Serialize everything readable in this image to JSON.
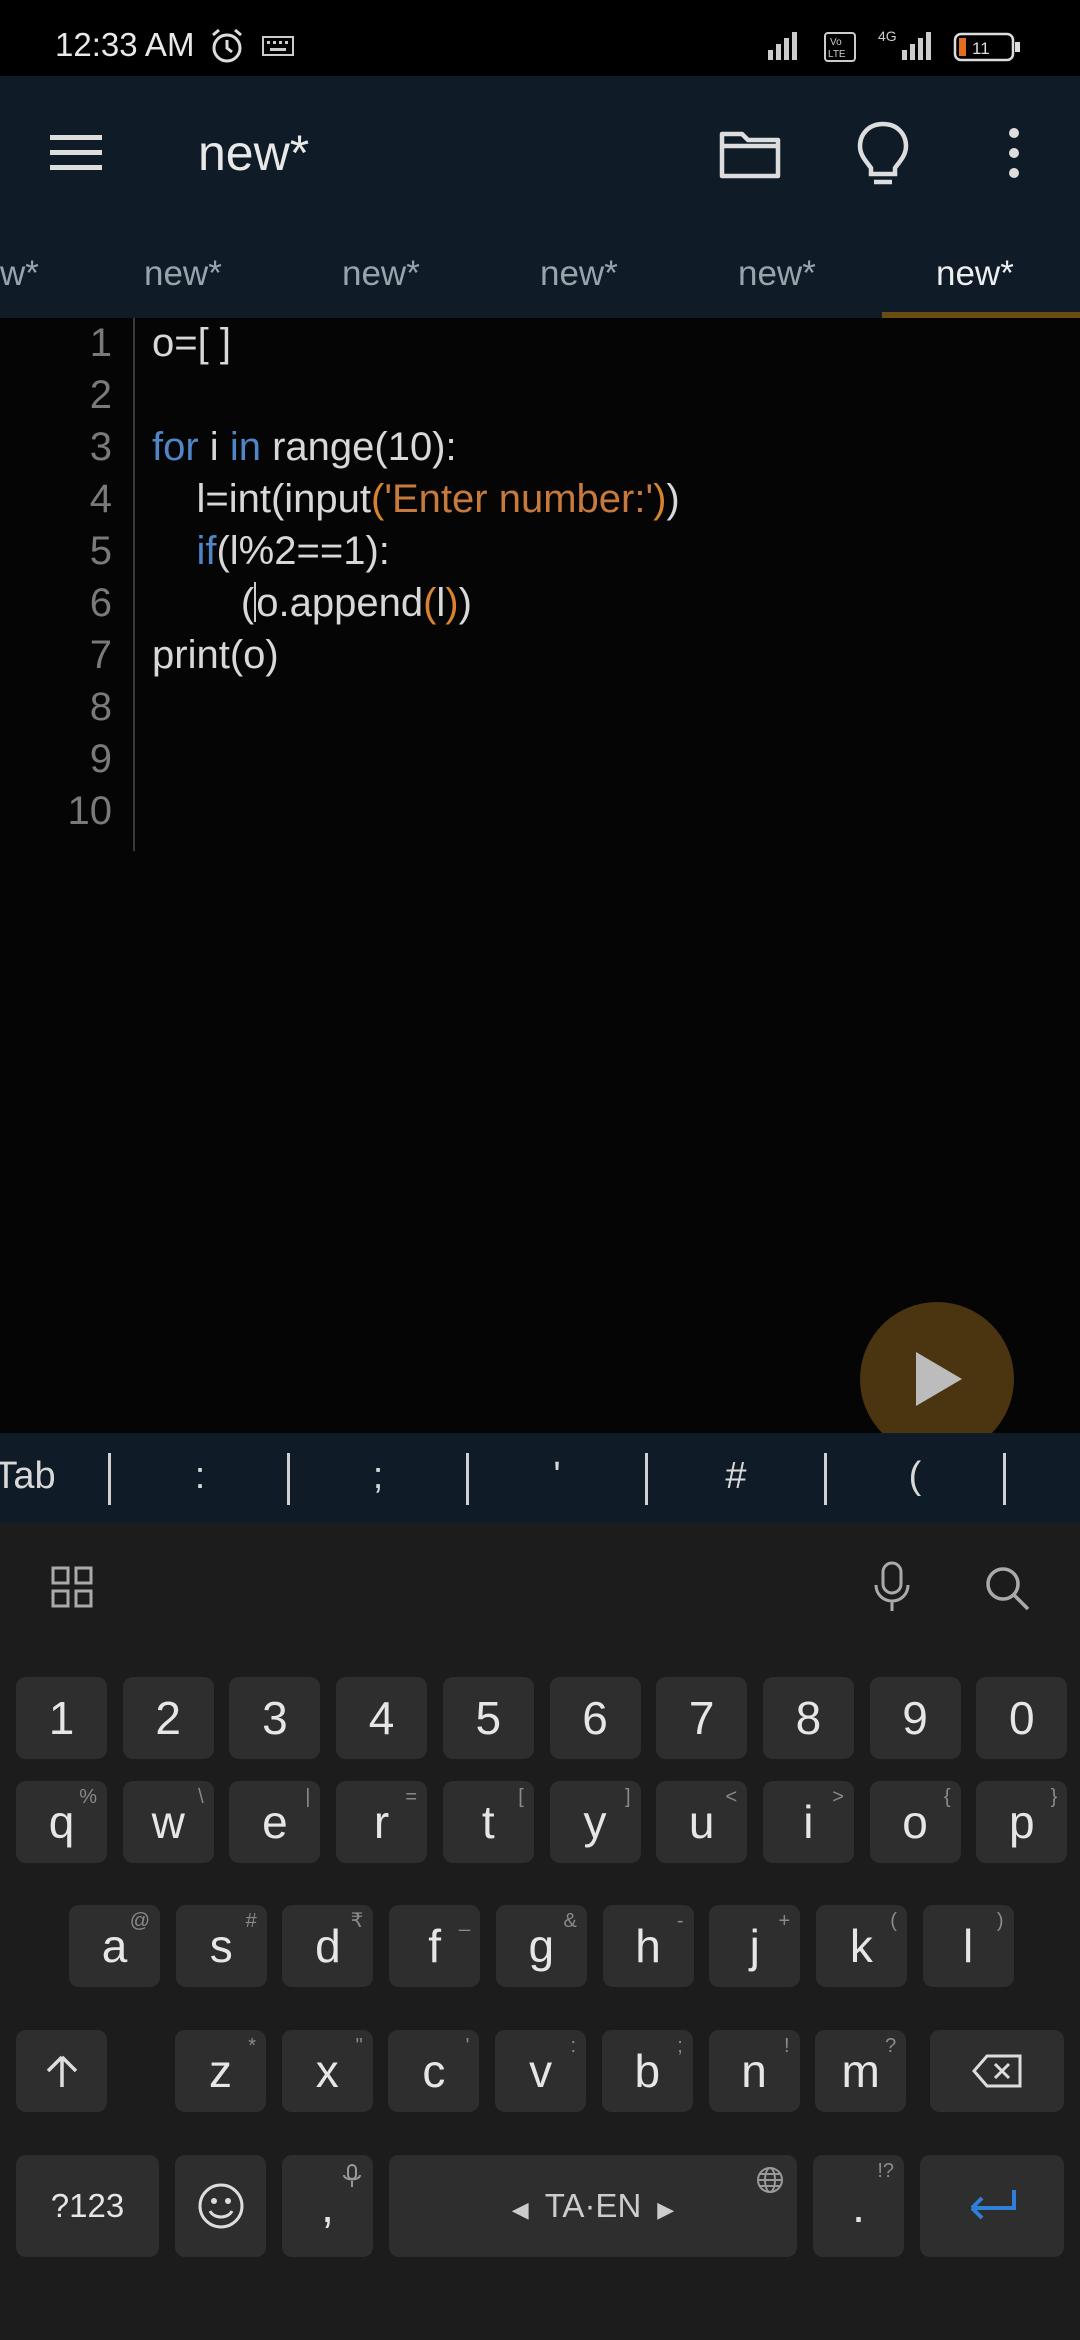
{
  "status_bar": {
    "time": "12:33 AM",
    "network": "4G",
    "battery": "11"
  },
  "app_bar": {
    "title": "new*"
  },
  "tabs": [
    {
      "label": "w*"
    },
    {
      "label": "new*"
    },
    {
      "label": "new*"
    },
    {
      "label": "new*"
    },
    {
      "label": "new*"
    },
    {
      "label": "new*",
      "active": true
    }
  ],
  "editor": {
    "line_numbers": [
      "1",
      "2",
      "3",
      "4",
      "5",
      "6",
      "7",
      "8",
      "9",
      "10"
    ]
  },
  "symbols": [
    "Tab",
    ":",
    ";",
    "'",
    "#",
    "("
  ],
  "keyboard": {
    "number_row": [
      "1",
      "2",
      "3",
      "4",
      "5",
      "6",
      "7",
      "8",
      "9",
      "0"
    ],
    "row1": [
      {
        "k": "q",
        "h": "%"
      },
      {
        "k": "w",
        "h": "\\"
      },
      {
        "k": "e",
        "h": "|"
      },
      {
        "k": "r",
        "h": "="
      },
      {
        "k": "t",
        "h": "["
      },
      {
        "k": "y",
        "h": "]"
      },
      {
        "k": "u",
        "h": "<"
      },
      {
        "k": "i",
        "h": ">"
      },
      {
        "k": "o",
        "h": "{"
      },
      {
        "k": "p",
        "h": "}"
      }
    ],
    "row2": [
      {
        "k": "a",
        "h": "@"
      },
      {
        "k": "s",
        "h": "#"
      },
      {
        "k": "d",
        "h": "₹"
      },
      {
        "k": "f",
        "h": "_"
      },
      {
        "k": "g",
        "h": "&"
      },
      {
        "k": "h",
        "h": "-"
      },
      {
        "k": "j",
        "h": "+"
      },
      {
        "k": "k",
        "h": "("
      },
      {
        "k": "l",
        "h": ")"
      }
    ],
    "row3": [
      {
        "k": "z",
        "h": "*"
      },
      {
        "k": "x",
        "h": "\""
      },
      {
        "k": "c",
        "h": "'"
      },
      {
        "k": "v",
        "h": ":"
      },
      {
        "k": "b",
        "h": ";"
      },
      {
        "k": "n",
        "h": "!"
      },
      {
        "k": "m",
        "h": "?"
      }
    ],
    "symbols_key": "?123",
    "comma_key": ",",
    "space_label": "TA·EN",
    "period_key": ".",
    "period_hint": "!?"
  },
  "colors": {
    "keyword": "#4f86c6",
    "string": "#c87a3c",
    "bracket": "#d7822c",
    "appbar": "#0f1b27",
    "accent": "#6a4d10"
  }
}
